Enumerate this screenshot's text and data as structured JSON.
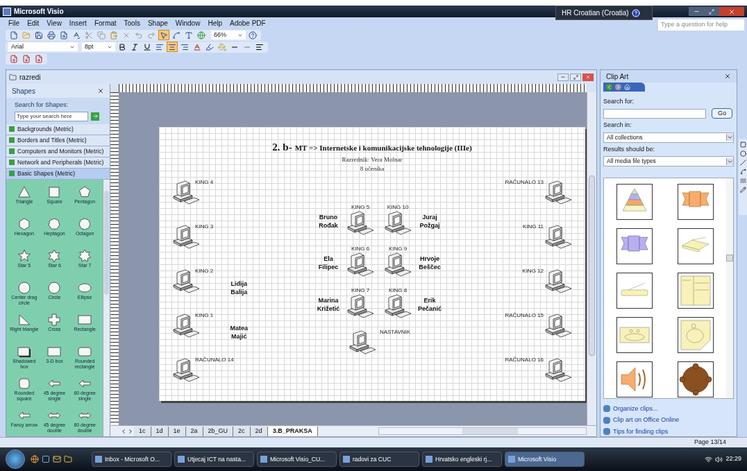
{
  "window": {
    "title": "Microsoft Visio"
  },
  "language_bar": {
    "label": "HR Croatian (Croatia)"
  },
  "help_search": {
    "placeholder": "Type a question for help"
  },
  "menu": [
    "File",
    "Edit",
    "View",
    "Insert",
    "Format",
    "Tools",
    "Shape",
    "Window",
    "Help",
    "Adobe PDF"
  ],
  "toolbar": {
    "zoom": "66%",
    "font": "Arial",
    "font_size": "8pt",
    "pointer_tool_on": true,
    "align_center_on": true
  },
  "document": {
    "title": "razredi"
  },
  "shapes_panel": {
    "title": "Shapes",
    "search_label": "Search for Shapes:",
    "search_placeholder": "Type your search here",
    "stencils": [
      {
        "label": "Backgrounds (Metric)",
        "selected": false
      },
      {
        "label": "Borders and Titles (Metric)",
        "selected": false
      },
      {
        "label": "Computers and Monitors (Metric)",
        "selected": false
      },
      {
        "label": "Network and Peripherals (Metric)",
        "selected": false
      },
      {
        "label": "Basic Shapes (Metric)",
        "selected": true
      }
    ],
    "shapes": [
      {
        "label": "Triangle",
        "kind": "triangle"
      },
      {
        "label": "Square",
        "kind": "square"
      },
      {
        "label": "Pentagon",
        "kind": "pentagon"
      },
      {
        "label": "Hexagon",
        "kind": "hexagon"
      },
      {
        "label": "Heptagon",
        "kind": "heptagon"
      },
      {
        "label": "Octagon",
        "kind": "octagon"
      },
      {
        "label": "Star 5",
        "kind": "star5"
      },
      {
        "label": "Star 6",
        "kind": "star6"
      },
      {
        "label": "Star 7",
        "kind": "star7"
      },
      {
        "label": "Center drag circle",
        "kind": "circle"
      },
      {
        "label": "Circle",
        "kind": "circle"
      },
      {
        "label": "Ellipse",
        "kind": "ellipse"
      },
      {
        "label": "Right triangle",
        "kind": "right-triangle"
      },
      {
        "label": "Cross",
        "kind": "cross"
      },
      {
        "label": "Rectangle",
        "kind": "rectangle"
      },
      {
        "label": "Shadowed box",
        "kind": "shadowed-box"
      },
      {
        "label": "3-D box",
        "kind": "rectangle"
      },
      {
        "label": "Rounded rectangle",
        "kind": "rounded-rectangle"
      },
      {
        "label": "Rounded square",
        "kind": "rounded-square"
      },
      {
        "label": "45 degree single",
        "kind": "arrow"
      },
      {
        "label": "60 degree single",
        "kind": "arrow"
      },
      {
        "label": "Fancy arrow",
        "kind": "arrow"
      },
      {
        "label": "45 degree double",
        "kind": "double-arrow"
      },
      {
        "label": "60 degree double",
        "kind": "double-arrow"
      }
    ]
  },
  "diagram": {
    "title_prefix": "2. b-",
    "title": "MT => Internetske i komunikacijske tehnologije (IIIe)",
    "subtitle": "Razrednik: Vera Molnar",
    "count": "8 učenika",
    "left_column": [
      {
        "label": "KING 4"
      },
      {
        "label": "KING 3"
      },
      {
        "label": "KING 2",
        "student": "Lidija Balija"
      },
      {
        "label": "KING 1",
        "student": "Matea Majić"
      },
      {
        "label": "RAČUNALO 14"
      }
    ],
    "center_pairs": [
      [
        {
          "label": "KING 5",
          "student": "Bruno Rođak"
        },
        {
          "label": "KING 10",
          "student": "Juraj Požgaj"
        }
      ],
      [
        {
          "label": "KING 6",
          "student": "Ela Filipec"
        },
        {
          "label": "KING 9",
          "student": "Hrvoje Beščec"
        }
      ],
      [
        {
          "label": "KING 7",
          "student": "Marina Križetić"
        },
        {
          "label": "KING 8",
          "student": "Erik Pečanić"
        }
      ]
    ],
    "teacher": {
      "label": "NASTAVNIK"
    },
    "right_column": [
      {
        "label": "RAČUNALO 13"
      },
      {
        "label": "KING 11"
      },
      {
        "label": "KING 12"
      },
      {
        "label": "RAČUNALO 15"
      },
      {
        "label": "RAČUNALO 16"
      }
    ]
  },
  "sheet_tabs": [
    {
      "label": "1c",
      "selected": false
    },
    {
      "label": "1d",
      "selected": false
    },
    {
      "label": "1e",
      "selected": false
    },
    {
      "label": "2a",
      "selected": false
    },
    {
      "label": "2b_GU",
      "selected": false
    },
    {
      "label": "2c",
      "selected": false
    },
    {
      "label": "2d",
      "selected": false
    },
    {
      "label": "3.B_PRAKSA",
      "selected": true
    }
  ],
  "clip_art": {
    "title": "Clip Art",
    "search_label": "Search for:",
    "go": "Go",
    "search_in_label": "Search in:",
    "search_in": "All collections",
    "results_label": "Results should be:",
    "results": "All media file types",
    "clips": [
      {
        "kind": "pyramid"
      },
      {
        "kind": "ribbon"
      },
      {
        "kind": "ribbon-alt"
      },
      {
        "kind": "tray"
      },
      {
        "kind": "scanner"
      },
      {
        "kind": "form"
      },
      {
        "kind": "sink"
      },
      {
        "kind": "corner-sink"
      },
      {
        "kind": "speaker"
      },
      {
        "kind": "round-table"
      }
    ],
    "links": [
      "Organize clips...",
      "Clip art on Office Online",
      "Tips for finding clips"
    ]
  },
  "status_bar": {
    "page": "Page 13/14"
  },
  "taskbar": {
    "items": [
      {
        "label": "Inbox - Microsoft O...",
        "selected": false
      },
      {
        "label": "Utjecaj ICT na nasta...",
        "selected": false
      },
      {
        "label": "Microsoft Visio_CU...",
        "selected": false
      },
      {
        "label": "radovi za CUC",
        "selected": false
      },
      {
        "label": "Hrvatsko engleski rj...",
        "selected": false
      },
      {
        "label": "Microsoft Visio",
        "selected": true
      }
    ],
    "clock": "22:29"
  }
}
